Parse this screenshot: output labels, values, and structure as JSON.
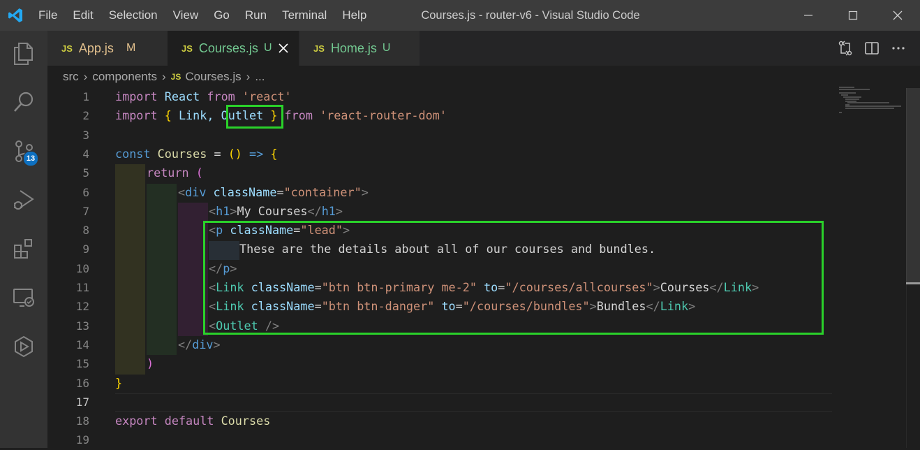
{
  "titlebar": {
    "menu": [
      "File",
      "Edit",
      "Selection",
      "View",
      "Go",
      "Run",
      "Terminal",
      "Help"
    ],
    "window_title": "Courses.js - router-v6 - Visual Studio Code"
  },
  "activitybar": {
    "icons": [
      "explorer-icon",
      "search-icon",
      "source-control-icon",
      "run-debug-icon",
      "extensions-icon",
      "remote-explorer-icon",
      "docker-icon"
    ],
    "source_control_badge": "13"
  },
  "tabs": [
    {
      "icon": "JS",
      "name": "App.js",
      "status": "M",
      "status_color": "#e2c08d",
      "name_color": "#e2c08d",
      "active": false
    },
    {
      "icon": "JS",
      "name": "Courses.js",
      "status": "U",
      "status_color": "#73c991",
      "name_color": "#73c991",
      "active": true
    },
    {
      "icon": "JS",
      "name": "Home.js",
      "status": "U",
      "status_color": "#73c991",
      "name_color": "#73c991",
      "active": false
    }
  ],
  "breadcrumb": {
    "parts": [
      "src",
      "components"
    ],
    "file_icon": "JS",
    "file": "Courses.js",
    "more": "..."
  },
  "editor": {
    "line_numbers": [
      "1",
      "2",
      "3",
      "4",
      "5",
      "6",
      "7",
      "8",
      "9",
      "10",
      "11",
      "12",
      "13",
      "14",
      "15",
      "16",
      "17",
      "18",
      "19"
    ],
    "current_line": "17",
    "lines": {
      "l1": {
        "a": "import",
        "b": "React",
        "c": "from",
        "d": "'react'"
      },
      "l2": {
        "a": "import",
        "b": "{",
        "c": "Link,",
        "d": "Outlet",
        "e": "}",
        "f": "from",
        "g": "'react-router-dom'"
      },
      "l4": {
        "a": "const",
        "b": "Courses",
        "c": "=",
        "d": "()",
        "e": "=>",
        "f": "{"
      },
      "l5": {
        "a": "return",
        "b": "("
      },
      "l6": {
        "a": "<",
        "b": "div",
        "c": "className",
        "d": "=",
        "e": "\"container\"",
        "f": ">"
      },
      "l7": {
        "a": "<",
        "b": "h1",
        "c": ">",
        "d": "My Courses",
        "e": "</",
        "f": "h1",
        "g": ">"
      },
      "l8": {
        "a": "<",
        "b": "p",
        "c": "className",
        "d": "=",
        "e": "\"lead\"",
        "f": ">"
      },
      "l9": {
        "a": "These are the details about all of our courses and bundles."
      },
      "l10": {
        "a": "</",
        "b": "p",
        "c": ">"
      },
      "l11": {
        "a": "<",
        "b": "Link",
        "c": "className",
        "d": "=",
        "e": "\"btn btn-primary me-2\"",
        "f": "to",
        "g": "=",
        "h": "\"/courses/allcourses\"",
        "i": ">",
        "j": "Courses",
        "k": "</",
        "l": "Link",
        "m": ">"
      },
      "l12": {
        "a": "<",
        "b": "Link",
        "c": "className",
        "d": "=",
        "e": "\"btn btn-danger\"",
        "f": "to",
        "g": "=",
        "h": "\"/courses/bundles\"",
        "i": ">",
        "j": "Bundles",
        "k": "</",
        "l": "Link",
        "m": ">"
      },
      "l13": {
        "a": "<",
        "b": "Outlet",
        "c": "/>"
      },
      "l14": {
        "a": "</",
        "b": "div",
        "c": ">"
      },
      "l15": {
        "a": ")"
      },
      "l16": {
        "a": "}"
      },
      "l18": {
        "a": "export",
        "b": "default",
        "c": "Courses"
      }
    },
    "highlight_color": "#2ad12a"
  }
}
